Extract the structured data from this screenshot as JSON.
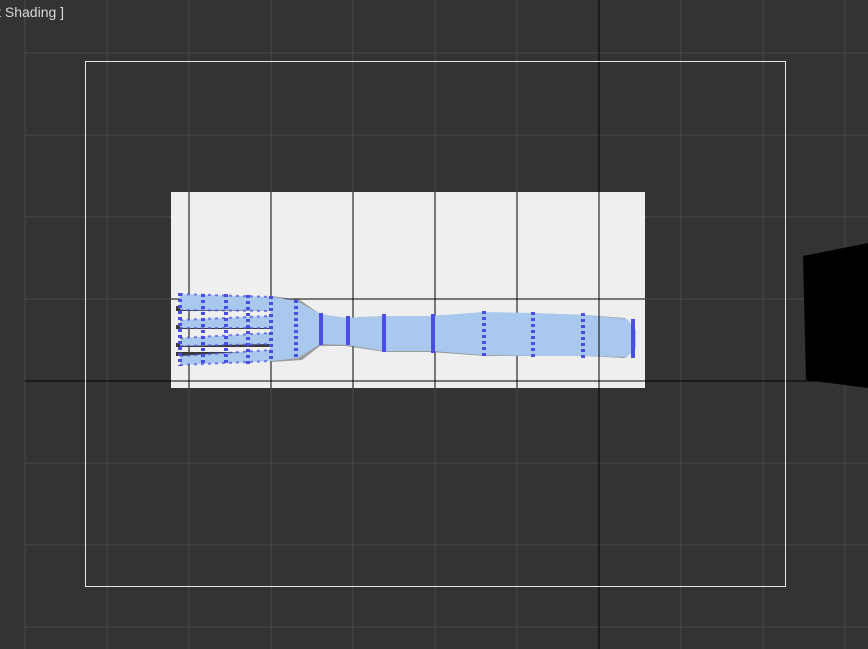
{
  "viewport": {
    "label": "lt Shading ]",
    "shading_mode_hint": "default-shading",
    "colors": {
      "background": "#333333",
      "grid_minor": "#4a4a4a",
      "grid_major": "#000000",
      "safe_frame": "#e6e6e6",
      "reference_plane": "#efefef",
      "mesh_fill": "#a9c8ee",
      "edge_selection": "#4a4ee6",
      "side_object": "#000000"
    }
  },
  "scene": {
    "reference_image_name": "fork-reference-plane",
    "mesh_name": "fork-mesh",
    "side_object_name": "side-object"
  }
}
